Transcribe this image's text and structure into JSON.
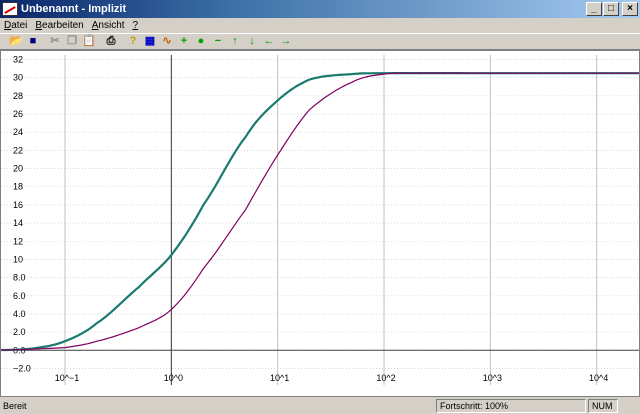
{
  "window": {
    "title": "Unbenannt - Implizit"
  },
  "menu": [
    {
      "accel": "D",
      "rest": "atei"
    },
    {
      "accel": "B",
      "rest": "earbeiten"
    },
    {
      "accel": "A",
      "rest": "nsicht"
    },
    {
      "accel": "?",
      "rest": ""
    }
  ],
  "toolbar": [
    {
      "name": "open-icon",
      "glyph": "📂",
      "color": "#c8a000"
    },
    {
      "name": "save-icon",
      "glyph": "■",
      "color": "#000080",
      "sep": true
    },
    {
      "name": "cut-icon",
      "glyph": "✂",
      "color": "#909090"
    },
    {
      "name": "copy-icon",
      "glyph": "❐",
      "color": "#909090"
    },
    {
      "name": "paste-icon",
      "glyph": "📋",
      "color": "#909090",
      "sep": true
    },
    {
      "name": "print-icon",
      "glyph": "⎙",
      "color": "#000",
      "sep": true
    },
    {
      "name": "help-icon",
      "glyph": "?",
      "color": "#c8a000"
    },
    {
      "name": "grid-icon",
      "glyph": "▦",
      "color": "#0000c0"
    },
    {
      "name": "function-icon",
      "glyph": "∿",
      "color": "#c06000"
    },
    {
      "name": "add-icon",
      "glyph": "+",
      "color": "#00a000"
    },
    {
      "name": "circle-icon",
      "glyph": "●",
      "color": "#00a000"
    },
    {
      "name": "minus-icon",
      "glyph": "−",
      "color": "#00a000"
    },
    {
      "name": "arrow-up-icon",
      "glyph": "↑",
      "color": "#00a000"
    },
    {
      "name": "arrow-down-icon",
      "glyph": "↓",
      "color": "#00a000"
    },
    {
      "name": "arrow-left-icon",
      "glyph": "←",
      "color": "#00a000"
    },
    {
      "name": "arrow-right-icon",
      "glyph": "→",
      "color": "#00a000"
    }
  ],
  "statusbar": {
    "ready": "Bereit",
    "progress": "Fortschritt: 100%",
    "num": "NUM"
  },
  "chart_data": {
    "type": "line",
    "x_scale": "log",
    "xlim": [
      0.025,
      25000
    ],
    "ylim": [
      -2.5,
      32.5
    ],
    "grid": true,
    "y_ticks": [
      "32",
      "30",
      "28",
      "26",
      "24",
      "22",
      "20",
      "18",
      "16",
      "14",
      "12",
      "10",
      "8.0",
      "6.0",
      "4.0",
      "2.0",
      "0.0",
      "−2.0"
    ],
    "y_tick_values": [
      32,
      30,
      28,
      26,
      24,
      22,
      20,
      18,
      16,
      14,
      12,
      10,
      8,
      6,
      4,
      2,
      0,
      -2
    ],
    "x_ticks": [
      "10^−1",
      "10^0",
      "10^1",
      "10^2",
      "10^3",
      "10^4"
    ],
    "x_tick_values": [
      0.1,
      1,
      10,
      100,
      1000,
      10000
    ],
    "series": [
      {
        "color": "#1a7a6e",
        "width": 2.2,
        "points": [
          [
            0.02,
            0.0
          ],
          [
            0.05,
            0.2
          ],
          [
            0.1,
            1.0
          ],
          [
            0.2,
            3.0
          ],
          [
            0.5,
            7.0
          ],
          [
            1,
            10.5
          ],
          [
            2,
            16.0
          ],
          [
            5,
            23.5
          ],
          [
            10,
            27.5
          ],
          [
            20,
            29.8
          ],
          [
            50,
            30.4
          ],
          [
            100,
            30.5
          ],
          [
            1000,
            30.5
          ],
          [
            25000,
            30.5
          ]
        ]
      },
      {
        "color": "#800060",
        "width": 1.2,
        "points": [
          [
            0.02,
            0.0
          ],
          [
            0.1,
            0.3
          ],
          [
            0.2,
            1.0
          ],
          [
            0.5,
            2.5
          ],
          [
            1,
            4.5
          ],
          [
            2,
            9.0
          ],
          [
            5,
            15.5
          ],
          [
            10,
            21.5
          ],
          [
            20,
            26.5
          ],
          [
            50,
            29.5
          ],
          [
            100,
            30.4
          ],
          [
            200,
            30.5
          ],
          [
            1000,
            30.5
          ],
          [
            25000,
            30.5
          ]
        ]
      }
    ]
  },
  "colors": {
    "title_start": "#0a246a",
    "title_end": "#a6caf0",
    "axis": "#404040",
    "grid": "#c0c0c0"
  }
}
